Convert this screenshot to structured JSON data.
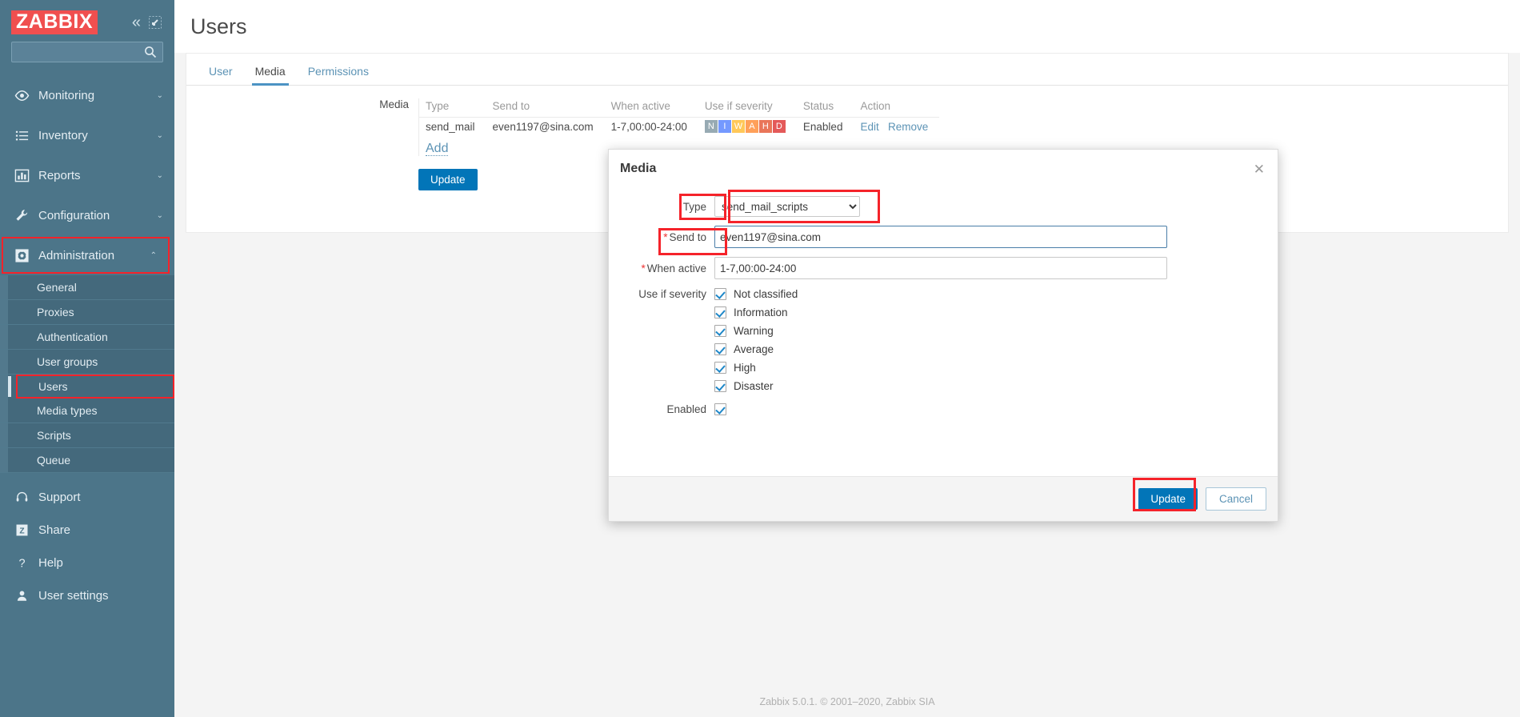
{
  "brand": {
    "logo": "ZABBIX",
    "accent": "#f04f4f",
    "sidebar_bg": "#4c7589"
  },
  "sidebar": {
    "search_placeholder": "",
    "search_value": "",
    "menu": [
      {
        "label": "Monitoring",
        "icon": "eye-icon",
        "arrow": "⌄"
      },
      {
        "label": "Inventory",
        "icon": "list-icon",
        "arrow": "⌄"
      },
      {
        "label": "Reports",
        "icon": "bar-chart-icon",
        "arrow": "⌄"
      },
      {
        "label": "Configuration",
        "icon": "wrench-icon",
        "arrow": "⌄"
      },
      {
        "label": "Administration",
        "icon": "gear-icon",
        "arrow": "⌃"
      }
    ],
    "submenu": [
      {
        "label": "General"
      },
      {
        "label": "Proxies"
      },
      {
        "label": "Authentication"
      },
      {
        "label": "User groups"
      },
      {
        "label": "Users"
      },
      {
        "label": "Media types"
      },
      {
        "label": "Scripts"
      },
      {
        "label": "Queue"
      }
    ],
    "bottom": [
      {
        "label": "Support",
        "icon": "headset-icon"
      },
      {
        "label": "Share",
        "icon": "zabbix-share-icon"
      },
      {
        "label": "Help",
        "icon": "question-icon"
      },
      {
        "label": "User settings",
        "icon": "person-icon"
      }
    ]
  },
  "header": {
    "title": "Users"
  },
  "tabs": [
    {
      "label": "User",
      "active": false
    },
    {
      "label": "Media",
      "active": true
    },
    {
      "label": "Permissions",
      "active": false
    }
  ],
  "media_form": {
    "section_label": "Media",
    "columns": [
      "Type",
      "Send to",
      "When active",
      "Use if severity",
      "Status",
      "Action"
    ],
    "rows": [
      {
        "type": "send_mail",
        "send_to": "even1197@sina.com",
        "when_active": "1-7,00:00-24:00",
        "severity": [
          {
            "letter": "N",
            "color": "#97aab3"
          },
          {
            "letter": "I",
            "color": "#7499ff"
          },
          {
            "letter": "W",
            "color": "#ffc859"
          },
          {
            "letter": "A",
            "color": "#ffa059"
          },
          {
            "letter": "H",
            "color": "#e97659"
          },
          {
            "letter": "D",
            "color": "#e45959"
          }
        ],
        "status": "Enabled",
        "actions": [
          "Edit",
          "Remove"
        ]
      }
    ],
    "add_link": "Add",
    "update_button": "Update"
  },
  "modal": {
    "title": "Media",
    "close_icon": "close-icon",
    "type_label": "Type",
    "type_value": "send_mail_scripts",
    "type_options": [
      "send_mail_scripts"
    ],
    "send_to_label": "Send to",
    "send_to_value": "even1197@sina.com",
    "send_to_required": "*",
    "when_active_label": "When active",
    "when_active_value": "1-7,00:00-24:00",
    "when_active_required": "*",
    "severity_label": "Use if severity",
    "severities": [
      {
        "label": "Not classified",
        "checked": true
      },
      {
        "label": "Information",
        "checked": true
      },
      {
        "label": "Warning",
        "checked": true
      },
      {
        "label": "Average",
        "checked": true
      },
      {
        "label": "High",
        "checked": true
      },
      {
        "label": "Disaster",
        "checked": true
      }
    ],
    "enabled_label": "Enabled",
    "enabled_checked": true,
    "update_button": "Update",
    "cancel_button": "Cancel"
  },
  "footer": {
    "credit": "Zabbix 5.0.1. © 2001–2020, Zabbix SIA"
  },
  "annotations": {
    "color": "#f5232a"
  }
}
